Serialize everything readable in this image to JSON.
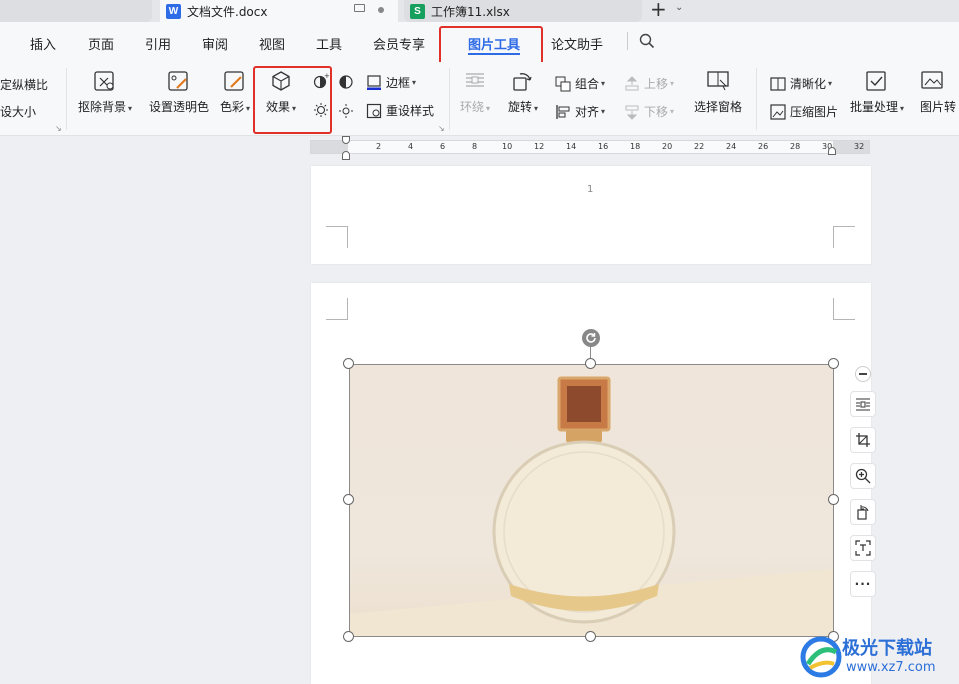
{
  "tabs": [
    {
      "label": "文档文件.docx",
      "icon_letter": "W",
      "icon_color": "#2e6be6"
    },
    {
      "label": "工作簿11.xlsx",
      "icon_letter": "S",
      "icon_color": "#17a05d"
    }
  ],
  "menu": {
    "items": [
      "插入",
      "页面",
      "引用",
      "审阅",
      "视图",
      "工具",
      "会员专享",
      "图片工具",
      "论文助手"
    ],
    "active": "图片工具",
    "active_color": "#2e6be6"
  },
  "ribbon": {
    "lock_ratio": "定纵横比",
    "reset_size": "设大小",
    "remove_bg": "抠除背景",
    "set_transparent": "设置透明色",
    "color": "色彩",
    "effects": "效果",
    "border": "边框",
    "reset_style": "重设样式",
    "wrap": "环绕",
    "rotate": "旋转",
    "group": "组合",
    "align": "对齐",
    "move_up": "上移",
    "move_down": "下移",
    "select_pane": "选择窗格",
    "sharpen": "清晰化",
    "compress": "压缩图片",
    "batch": "批量处理",
    "convert": "图片转"
  },
  "ruler": {
    "ticks": [
      "2",
      "4",
      "6",
      "8",
      "10",
      "12",
      "14",
      "16",
      "18",
      "20",
      "22",
      "24",
      "26",
      "28",
      "30",
      "32"
    ]
  },
  "document": {
    "page_number": "1"
  },
  "watermark": {
    "name": "极光下载站",
    "url": "www.xz7.com"
  },
  "highlight_color": "#e0302a"
}
